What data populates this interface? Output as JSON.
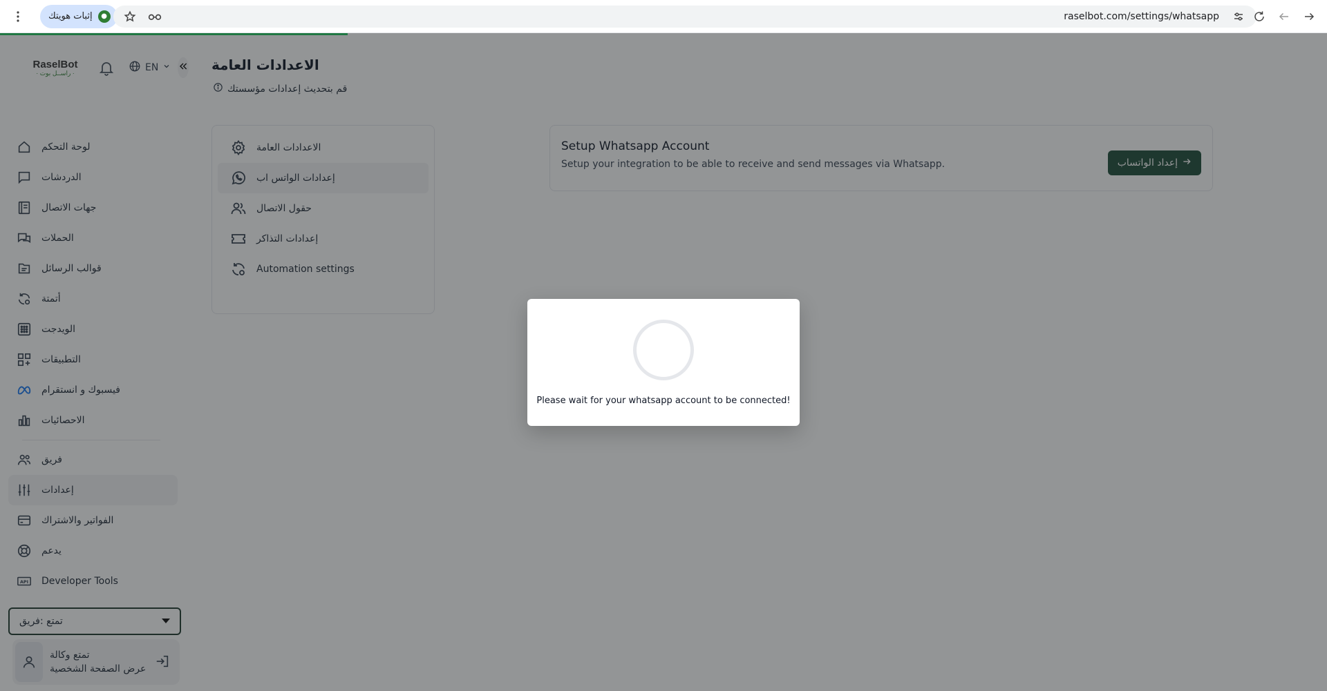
{
  "browser": {
    "profile_label": "إثبات هويتك",
    "url": "raselbot.com/settings/whatsapp"
  },
  "sidebar": {
    "logo_main": "RaselBot",
    "logo_sub": "· راســل بوت ·",
    "language": "EN",
    "items": [
      {
        "label": "لوحة التحكم",
        "icon": "home-icon"
      },
      {
        "label": "الدردشات",
        "icon": "chat-icon"
      },
      {
        "label": "جهات الاتصال",
        "icon": "contacts-icon"
      },
      {
        "label": "الحملات",
        "icon": "campaigns-icon"
      },
      {
        "label": "قوالب الرسائل",
        "icon": "templates-icon"
      },
      {
        "label": "أتمتة",
        "icon": "automation-icon"
      },
      {
        "label": "الويدجت",
        "icon": "widget-grid-icon"
      },
      {
        "label": "التطبيقات",
        "icon": "apps-icon"
      },
      {
        "label": "فيسبوك و انستقرام",
        "icon": "meta-icon"
      },
      {
        "label": "الاحصائيات",
        "icon": "stats-icon"
      },
      {
        "label": "فريق",
        "icon": "team-icon"
      },
      {
        "label": "إعدادات",
        "icon": "settings-sliders-icon"
      },
      {
        "label": "الفواتير والاشتراك",
        "icon": "billing-icon"
      },
      {
        "label": "يدعم",
        "icon": "support-icon"
      },
      {
        "label": "Developer Tools",
        "icon": "api-icon"
      }
    ],
    "team_select": "تمتع :فريق",
    "user": {
      "name": "تمتع وكالة",
      "profile_link": "عرض الصفحة الشخصية"
    }
  },
  "header": {
    "title": "الاعدادات العامة",
    "subtitle": "قم بتحديث إعدادات مؤسستك"
  },
  "settings_nav": [
    {
      "label": "الاعدادات العامة",
      "icon": "gear-icon"
    },
    {
      "label": "إعدادات الواتس اب",
      "icon": "whatsapp-icon"
    },
    {
      "label": "حقول الاتصال",
      "icon": "users-icon"
    },
    {
      "label": "إعدادات التذاكر",
      "icon": "ticket-icon"
    },
    {
      "label": "Automation settings",
      "icon": "automation-icon"
    }
  ],
  "whatsapp_card": {
    "title": "Setup Whatsapp Account",
    "description": "Setup your integration to be able to receive and send messages via Whatsapp.",
    "button": "إعداد الواتساب"
  },
  "modal": {
    "message": "Please wait for your whatsapp account to be connected!"
  }
}
